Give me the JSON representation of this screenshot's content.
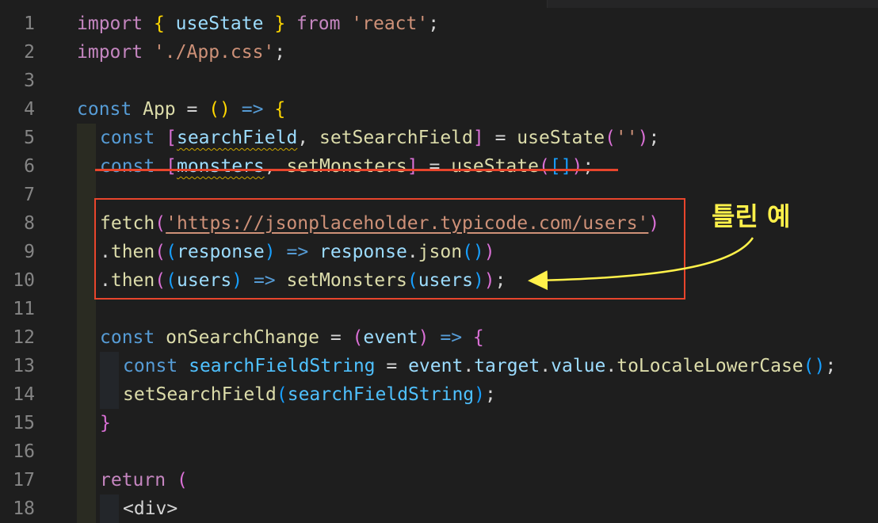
{
  "editor": {
    "lines": [
      {
        "n": "1",
        "indent": 0,
        "tokens": [
          [
            "imp",
            "import"
          ],
          [
            "pun",
            " "
          ],
          [
            "b1",
            "{"
          ],
          [
            "pun",
            " "
          ],
          [
            "var",
            "useState"
          ],
          [
            "pun",
            " "
          ],
          [
            "b1",
            "}"
          ],
          [
            "pun",
            " "
          ],
          [
            "imp",
            "from"
          ],
          [
            "pun",
            " "
          ],
          [
            "str",
            "'react'"
          ],
          [
            "pun",
            ";"
          ]
        ]
      },
      {
        "n": "2",
        "indent": 0,
        "tokens": [
          [
            "imp",
            "import"
          ],
          [
            "pun",
            " "
          ],
          [
            "str",
            "'./App.css'"
          ],
          [
            "pun",
            ";"
          ]
        ]
      },
      {
        "n": "3",
        "indent": 0,
        "tokens": []
      },
      {
        "n": "4",
        "indent": 0,
        "tokens": [
          [
            "kw",
            "const"
          ],
          [
            "pun",
            " "
          ],
          [
            "fn",
            "App"
          ],
          [
            "pun",
            " = "
          ],
          [
            "b1",
            "()"
          ],
          [
            "pun",
            " "
          ],
          [
            "kw",
            "=>"
          ],
          [
            "pun",
            " "
          ],
          [
            "b1",
            "{"
          ]
        ]
      },
      {
        "n": "5",
        "indent": 1,
        "tokens": [
          [
            "kw",
            "const"
          ],
          [
            "pun",
            " "
          ],
          [
            "b2",
            "["
          ],
          [
            "var squig",
            "searchField"
          ],
          [
            "pun",
            ", "
          ],
          [
            "fn",
            "setSearchField"
          ],
          [
            "b2",
            "]"
          ],
          [
            "pun",
            " = "
          ],
          [
            "fn",
            "useState"
          ],
          [
            "b2",
            "("
          ],
          [
            "str",
            "''"
          ],
          [
            "b2",
            ")"
          ],
          [
            "pun",
            ";"
          ]
        ]
      },
      {
        "n": "6",
        "indent": 1,
        "tokens": [
          [
            "kw",
            "const"
          ],
          [
            "pun",
            " "
          ],
          [
            "b2",
            "["
          ],
          [
            "var squig",
            "monsters"
          ],
          [
            "pun",
            ", "
          ],
          [
            "fn",
            "setMonsters"
          ],
          [
            "b2",
            "]"
          ],
          [
            "pun",
            " = "
          ],
          [
            "fn",
            "useState"
          ],
          [
            "b2",
            "("
          ],
          [
            "b3",
            "[]"
          ],
          [
            "b2",
            ")"
          ],
          [
            "pun",
            ";"
          ]
        ]
      },
      {
        "n": "7",
        "indent": 1,
        "tokens": []
      },
      {
        "n": "8",
        "indent": 1,
        "tokens": [
          [
            "fn",
            "fetch"
          ],
          [
            "b2",
            "("
          ],
          [
            "str link",
            "'https://jsonplaceholder.typicode.com/users'"
          ],
          [
            "b2",
            ")"
          ]
        ]
      },
      {
        "n": "9",
        "indent": 1,
        "tokens": [
          [
            "pun",
            "."
          ],
          [
            "fn",
            "then"
          ],
          [
            "b2",
            "("
          ],
          [
            "b3",
            "("
          ],
          [
            "var",
            "response"
          ],
          [
            "b3",
            ")"
          ],
          [
            "pun",
            " "
          ],
          [
            "kw",
            "=>"
          ],
          [
            "pun",
            " "
          ],
          [
            "var",
            "response"
          ],
          [
            "pun",
            "."
          ],
          [
            "fn",
            "json"
          ],
          [
            "b3",
            "()"
          ],
          [
            "b2",
            ")"
          ]
        ]
      },
      {
        "n": "10",
        "indent": 1,
        "tokens": [
          [
            "pun",
            "."
          ],
          [
            "fn",
            "then"
          ],
          [
            "b2",
            "("
          ],
          [
            "b3",
            "("
          ],
          [
            "var",
            "users"
          ],
          [
            "b3",
            ")"
          ],
          [
            "pun",
            " "
          ],
          [
            "kw",
            "=>"
          ],
          [
            "pun",
            " "
          ],
          [
            "fn",
            "setMonsters"
          ],
          [
            "b3",
            "("
          ],
          [
            "var",
            "users"
          ],
          [
            "b3",
            ")"
          ],
          [
            "b2",
            ")"
          ],
          [
            "pun",
            ";"
          ]
        ]
      },
      {
        "n": "11",
        "indent": 1,
        "tokens": []
      },
      {
        "n": "12",
        "indent": 1,
        "tokens": [
          [
            "kw",
            "const"
          ],
          [
            "pun",
            " "
          ],
          [
            "fn",
            "onSearchChange"
          ],
          [
            "pun",
            " = "
          ],
          [
            "b2",
            "("
          ],
          [
            "var",
            "event"
          ],
          [
            "b2",
            ")"
          ],
          [
            "pun",
            " "
          ],
          [
            "kw",
            "=>"
          ],
          [
            "pun",
            " "
          ],
          [
            "b2",
            "{"
          ]
        ]
      },
      {
        "n": "13",
        "indent": 2,
        "tokens": [
          [
            "kw",
            "const"
          ],
          [
            "pun",
            " "
          ],
          [
            "cls",
            "searchFieldString"
          ],
          [
            "pun",
            " = "
          ],
          [
            "var",
            "event"
          ],
          [
            "pun",
            "."
          ],
          [
            "var",
            "target"
          ],
          [
            "pun",
            "."
          ],
          [
            "var",
            "value"
          ],
          [
            "pun",
            "."
          ],
          [
            "fn",
            "toLocaleLowerCase"
          ],
          [
            "b3",
            "()"
          ],
          [
            "pun",
            ";"
          ]
        ]
      },
      {
        "n": "14",
        "indent": 2,
        "tokens": [
          [
            "fn",
            "setSearchField"
          ],
          [
            "b3",
            "("
          ],
          [
            "cls",
            "searchFieldString"
          ],
          [
            "b3",
            ")"
          ],
          [
            "pun",
            ";"
          ]
        ]
      },
      {
        "n": "15",
        "indent": 1,
        "tokens": [
          [
            "b2",
            "}"
          ]
        ]
      },
      {
        "n": "16",
        "indent": 1,
        "tokens": []
      },
      {
        "n": "17",
        "indent": 1,
        "tokens": [
          [
            "imp",
            "return"
          ],
          [
            "pun",
            " "
          ],
          [
            "b2",
            "("
          ]
        ]
      },
      {
        "n": "18",
        "indent": 2,
        "tokens": [
          [
            "pun",
            "<div>"
          ]
        ]
      }
    ]
  },
  "annotation": {
    "label": "틀린 예",
    "color": "#fff14a",
    "highlight_color": "#e8452c"
  }
}
